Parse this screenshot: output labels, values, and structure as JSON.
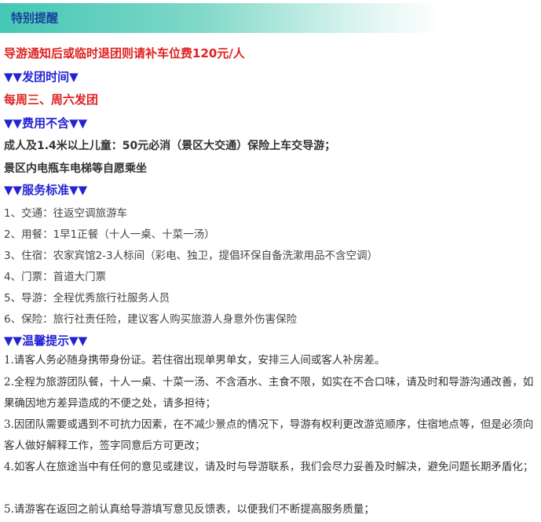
{
  "header": {
    "title": "特别提醒"
  },
  "notice": "导游通知后或临时退团则请补车位费120元/人",
  "departure": {
    "heading": "▼▼发团时间▼",
    "text": "每周三、周六发团"
  },
  "excluded": {
    "heading": "▼▼费用不含▼▼",
    "lines": [
      "成人及1.4米以上儿童：50元必消（景区大交通）保险上车交导游；",
      "景区内电瓶车电梯等自愿乘坐"
    ]
  },
  "service": {
    "heading": "▼▼服务标准▼▼",
    "items": [
      "1、交通：往返空调旅游车",
      "2、用餐：1早1正餐（十人一桌、十菜一汤）",
      "3、住宿：农家宾馆2-3人标间（彩电、独卫，提倡环保自备洗漱用品不含空调）",
      "4、门票：首道大门票",
      "5、导游：全程优秀旅行社服务人员",
      "6、保险：旅行社责任险，建议客人购买旅游人身意外伤害保险"
    ]
  },
  "tips": {
    "heading": "▼▼温馨提示▼▼",
    "items": [
      "1.请客人务必随身携带身份证。若住宿出现单男单女，安排三人间或客人补房差。",
      "2.全程为旅游团队餐，十人一桌、十菜一汤、不含酒水、主食不限，如实在不合口味，请及时和导游沟通改善，如果确因地方差异造成的不便之处，请多担待；",
      "3.因团队需要或遇到不可抗力因素，在不减少景点的情况下，导游有权利更改游览顺序，住宿地点等，但是必须向客人做好解释工作，签字同意后方可更改；",
      "4.如客人在旅途当中有任何的意见或建议，请及时与导游联系，我们会尽力妥善及时解决，避免问题长期矛盾化；",
      "5.请游客在返回之前认真给导游填写意见反馈表，以便我们不断提高服务质量；"
    ]
  }
}
